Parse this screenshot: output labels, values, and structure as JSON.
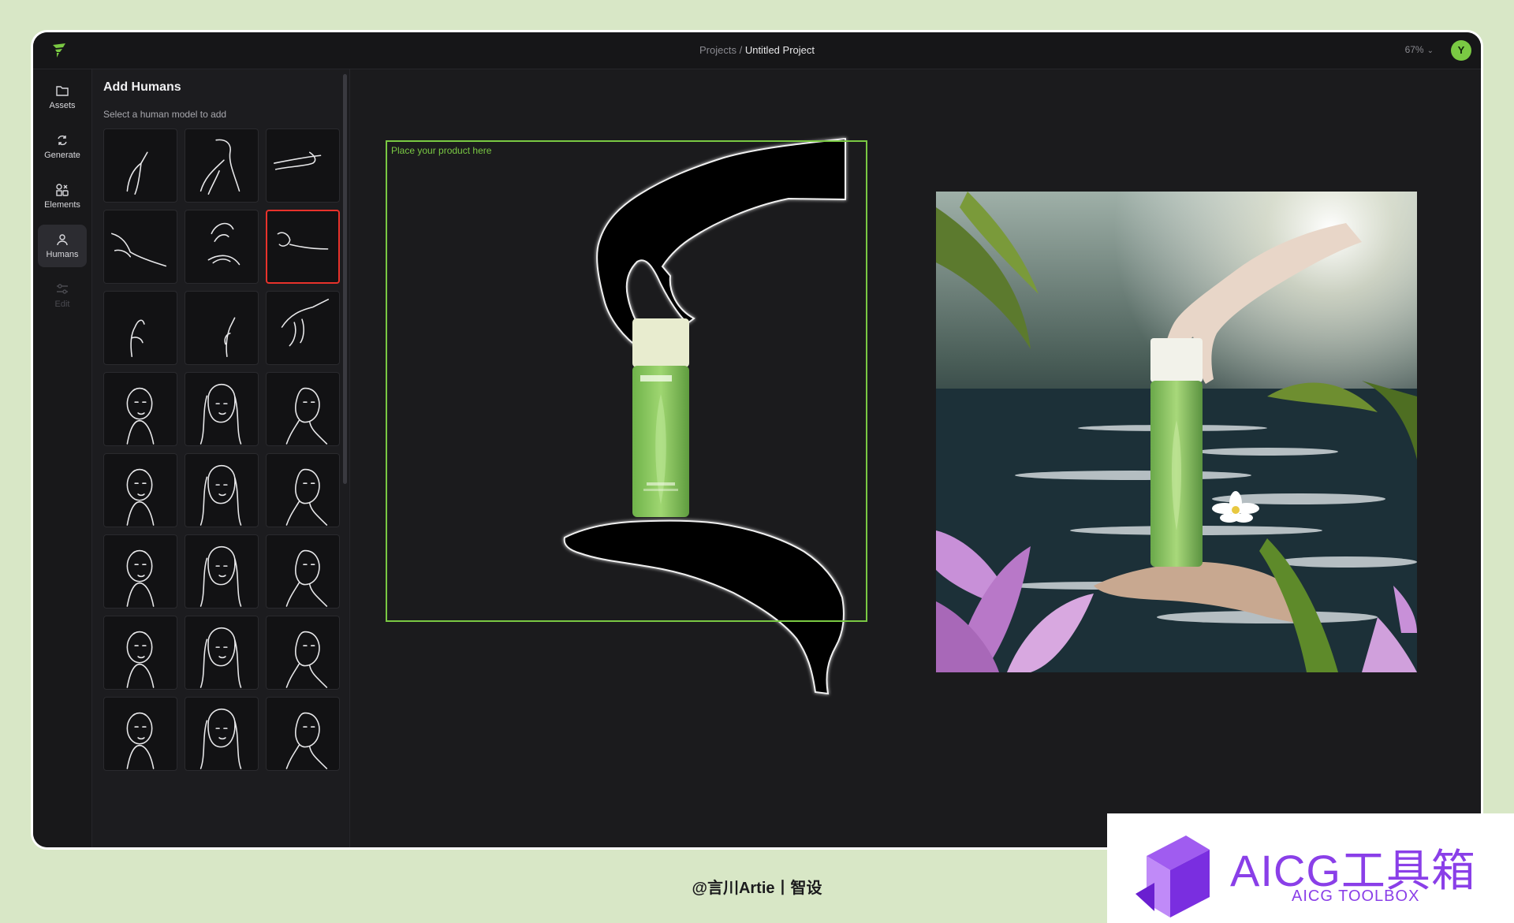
{
  "header": {
    "breadcrumb_parent": "Projects",
    "breadcrumb_sep": " / ",
    "breadcrumb_current": "Untitled Project",
    "zoom": "67%",
    "avatar_initial": "Y"
  },
  "rail": {
    "items": [
      {
        "label": "Assets",
        "icon": "folder-icon"
      },
      {
        "label": "Generate",
        "icon": "refresh-icon"
      },
      {
        "label": "Elements",
        "icon": "shapes-icon"
      },
      {
        "label": "Humans",
        "icon": "person-icon",
        "active": true
      },
      {
        "label": "Edit",
        "icon": "sliders-icon",
        "disabled": true
      }
    ]
  },
  "panel": {
    "title": "Add Humans",
    "subtitle": "Select a human model to add",
    "selected_tile": 5
  },
  "canvas": {
    "drop_label": "Place your product here"
  },
  "help": {
    "label": "?"
  },
  "footer": {
    "credit": "@言川Artie丨智设",
    "badge_title": "AICG工具箱",
    "badge_sub": "AICG TOOLBOX"
  },
  "colors": {
    "accent": "#7ac943",
    "selection": "#e8322b",
    "page_bg": "#d8e7c6",
    "badge": "#8a3fe8"
  }
}
